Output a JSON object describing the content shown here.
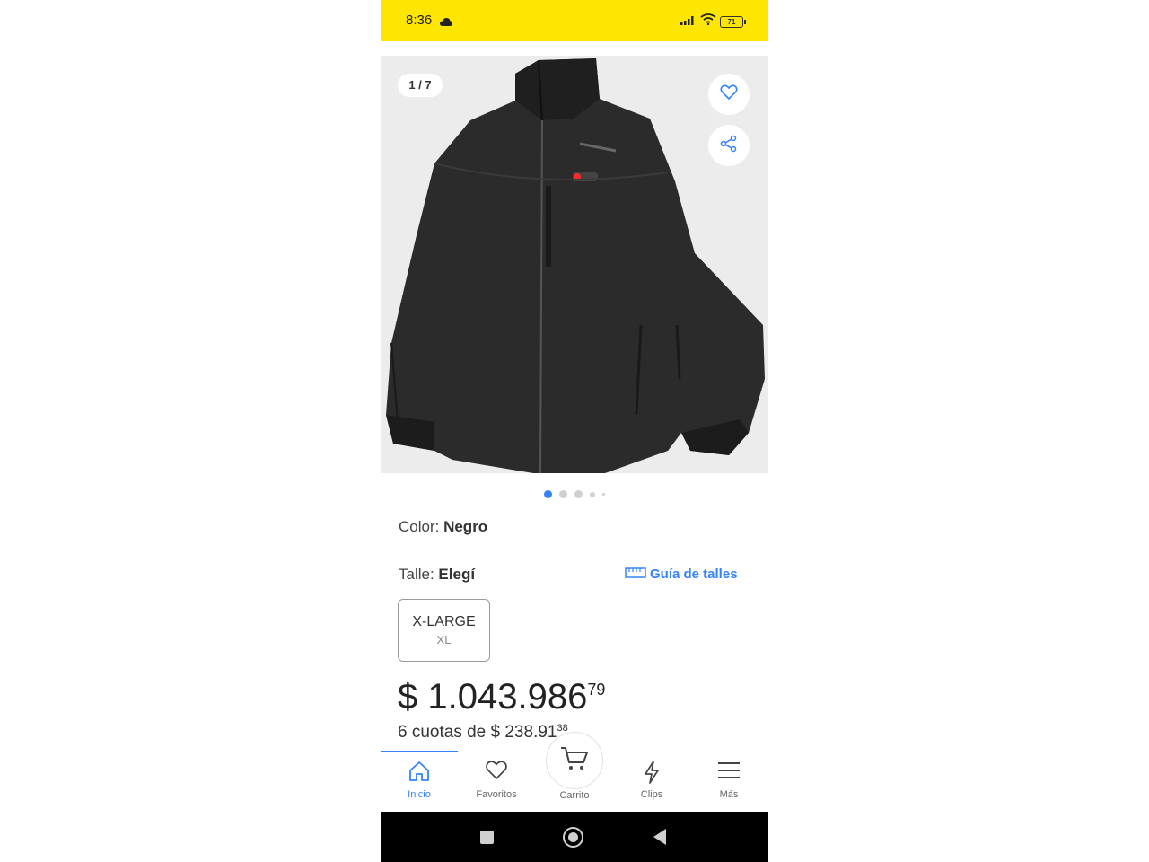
{
  "status_bar": {
    "time": "8:36",
    "battery": "71"
  },
  "product": {
    "image_counter": "1 / 7",
    "color_label": "Color: ",
    "color_value": "Negro",
    "size_label": "Talle: ",
    "size_value": "Elegí",
    "size_guide": "Guía de talles",
    "size_option": {
      "label": "X-LARGE",
      "sub": "XL"
    },
    "price_main": "$ 1.043.986",
    "price_cents": "79",
    "installments_main": "6 cuotas de $ 238.91",
    "installments_cents": "38"
  },
  "nav": {
    "inicio": "Inicio",
    "favoritos": "Favoritos",
    "carrito": "Carrito",
    "clips": "Clips",
    "mas": "Más"
  },
  "colors": {
    "accent": "#3483fa",
    "brand_yellow": "#ffe600"
  },
  "icons": [
    "cloud-icon",
    "signal-icon",
    "wifi-icon",
    "battery-icon",
    "heart-icon",
    "share-icon",
    "ruler-icon",
    "home-icon",
    "cart-icon",
    "lightning-icon",
    "menu-icon"
  ]
}
